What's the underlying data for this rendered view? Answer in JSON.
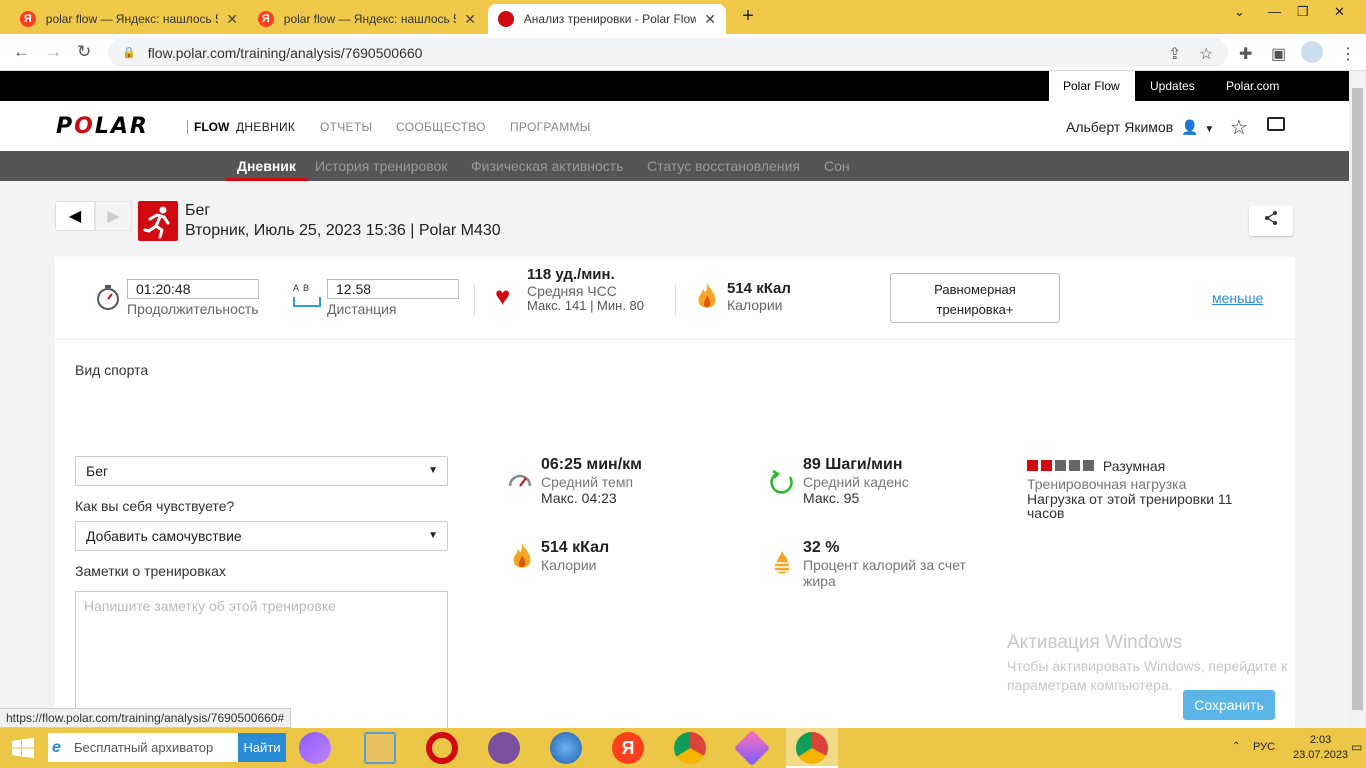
{
  "browser": {
    "tabs": [
      {
        "favicon": "Я",
        "title": "polar flow — Яндекс: нашлось 5",
        "active": false
      },
      {
        "favicon": "Я",
        "title": "polar flow — Яндекс: нашлось 5",
        "active": false
      },
      {
        "favicon": "polar",
        "title": "Анализ тренировки - Polar Flow",
        "active": true
      }
    ],
    "url": "flow.polar.com/training/analysis/7690500660",
    "status_url": "https://flow.polar.com/training/analysis/7690500660#"
  },
  "top_links": [
    "Polar Flow",
    "Updates",
    "Polar.com"
  ],
  "logo": {
    "pre": "P",
    "o": "O",
    "post": "LAR",
    "suffix": "FLOW"
  },
  "main_nav": [
    "ДНЕВНИК",
    "ОТЧЕТЫ",
    "СООБЩЕСТВО",
    "ПРОГРАММЫ"
  ],
  "user": {
    "name": "Альберт Якимов"
  },
  "sub_nav": [
    "Дневник",
    "История тренировок",
    "Физическая активность",
    "Статус восстановления",
    "Сон"
  ],
  "session": {
    "sport": "Бег",
    "date_line": "Вторник, Июль 25, 2023 15:36 | Polar M430"
  },
  "summary": {
    "duration": {
      "value": "01:20:48",
      "label": "Продолжительность"
    },
    "distance": {
      "ab": [
        "A",
        "B"
      ],
      "value": "12.58",
      "label": "Дистанция"
    },
    "hr": {
      "value": "118 уд./мин.",
      "label": "Средняя ЧСС",
      "minmax": "Макс. 141  |  Мин. 80"
    },
    "calories": {
      "value": "514 кКал",
      "label": "Калории"
    },
    "benefit_line1": "Равномерная",
    "benefit_line2": "тренировка+",
    "less_link": "меньше"
  },
  "form": {
    "sport_label": "Вид спорта",
    "sport_value": "Бег",
    "feeling_label": "Как вы себя чувствуете?",
    "feeling_value": "Добавить самочувствие",
    "notes_label": "Заметки о тренировках",
    "notes_placeholder": "Напишите заметку об этой тренировке"
  },
  "stats": {
    "pace": {
      "value": "06:25 мин/км",
      "label": "Средний темп",
      "max": "Макс. 04:23"
    },
    "cadence": {
      "value": "89 Шаги/мин",
      "label": "Средний каденс",
      "max": "Макс. 95"
    },
    "calories": {
      "value": "514 кКал",
      "label": "Калории"
    },
    "fat": {
      "value": "32 %",
      "label_line1": "Процент калорий за счет",
      "label_line2": "жира"
    },
    "load": {
      "level": "Разумная",
      "level_filled": 2,
      "level_total": 5,
      "label": "Тренировочная нагрузка",
      "desc_line1": "Нагрузка от этой тренировки 11",
      "desc_line2": "часов"
    }
  },
  "activation": {
    "title": "Активация Windows",
    "line1": "Чтобы активировать Windows, перейдите к",
    "line2": "параметрам компьютера."
  },
  "save_label": "Сохранить",
  "taskbar": {
    "search_placeholder": "Бесплатный архиватор",
    "search_btn": "Найти",
    "lang": "РУС",
    "time": "2:03",
    "date": "23.07.2023"
  },
  "colors": {
    "brand_red": "#d10a11",
    "yandex_bar": "#f0c94a",
    "link_blue": "#2a8bd6"
  }
}
